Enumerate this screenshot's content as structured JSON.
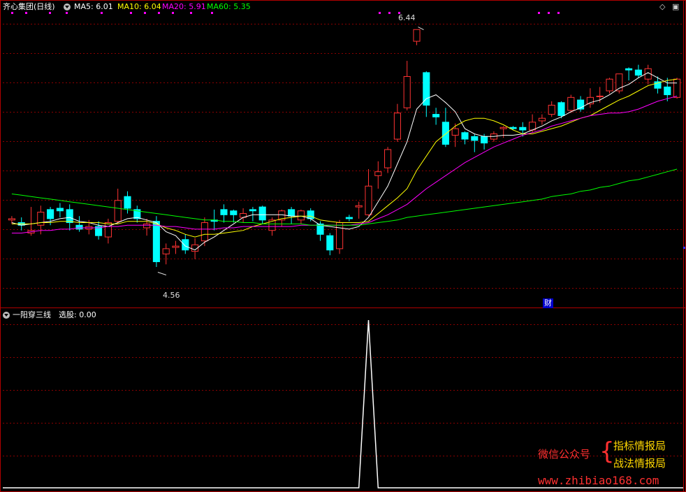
{
  "header": {
    "stock_name": "齐心集团(日线)",
    "ma_labels": [
      {
        "text": "MA5: 6.01",
        "color": "#ffffff"
      },
      {
        "text": "MA10: 6.04",
        "color": "#ffff00"
      },
      {
        "text": "MA20: 5.91",
        "color": "#ff00ff"
      },
      {
        "text": "MA60: 5.35",
        "color": "#00ff00"
      }
    ]
  },
  "indicator": {
    "name": "一阳穿三线",
    "value_label": "选股: 0.00"
  },
  "annotations": {
    "high_label": "6.44",
    "low_label": "4.56",
    "finance_marker": "财"
  },
  "watermark": {
    "prefix": "微信公众号",
    "line1": "指标情报局",
    "line2": "战法情报局",
    "url": "www.zhibiao168.com"
  },
  "controls": {
    "diamond_icon": "◇",
    "maximize_icon": "▣"
  },
  "colors": {
    "up": "#ff3333",
    "down": "#00ffff",
    "grid": "#8b0000",
    "frame": "#b00000",
    "ma5": "#ffffff",
    "ma10": "#ffff00",
    "ma20": "#ff00ff",
    "ma60": "#00ff00",
    "signal": "#ffffff"
  },
  "chart_data": [
    {
      "type": "candlestick",
      "title": "齐心集团(日线)",
      "ylim": [
        4.3,
        6.55
      ],
      "high_marker": 6.44,
      "low_marker": 4.56,
      "ohlc": [
        [
          4.96,
          4.99,
          4.93,
          4.97
        ],
        [
          4.94,
          4.98,
          4.88,
          4.92
        ],
        [
          4.86,
          5.06,
          4.84,
          4.88
        ],
        [
          4.92,
          5.07,
          4.85,
          5.02
        ],
        [
          5.04,
          5.06,
          4.92,
          4.97
        ],
        [
          5.05,
          5.09,
          4.98,
          5.03
        ],
        [
          5.04,
          5.08,
          4.88,
          4.94
        ],
        [
          4.92,
          4.99,
          4.87,
          4.89
        ],
        [
          4.89,
          4.96,
          4.85,
          4.91
        ],
        [
          4.91,
          4.95,
          4.81,
          4.84
        ],
        [
          4.83,
          4.97,
          4.78,
          4.94
        ],
        [
          4.95,
          5.2,
          4.93,
          5.11
        ],
        [
          5.14,
          5.18,
          5.01,
          5.05
        ],
        [
          5.04,
          5.07,
          4.94,
          4.97
        ],
        [
          4.9,
          4.97,
          4.84,
          4.93
        ],
        [
          4.95,
          4.99,
          4.6,
          4.64
        ],
        [
          4.7,
          4.78,
          4.62,
          4.74
        ],
        [
          4.75,
          4.8,
          4.7,
          4.76
        ],
        [
          4.81,
          4.85,
          4.7,
          4.73
        ],
        [
          4.72,
          4.82,
          4.66,
          4.77
        ],
        [
          4.8,
          4.98,
          4.76,
          4.94
        ],
        [
          4.96,
          5.04,
          4.88,
          4.95
        ],
        [
          5.04,
          5.08,
          4.94,
          5.0
        ],
        [
          5.03,
          5.04,
          4.94,
          5.0
        ],
        [
          4.98,
          5.05,
          4.94,
          5.01
        ],
        [
          5.04,
          5.06,
          4.95,
          5.03
        ],
        [
          5.06,
          5.07,
          4.93,
          4.96
        ],
        [
          4.88,
          4.98,
          4.84,
          4.96
        ],
        [
          4.96,
          5.04,
          4.91,
          5.03
        ],
        [
          5.04,
          5.06,
          4.93,
          4.99
        ],
        [
          4.96,
          5.04,
          4.93,
          5.03
        ],
        [
          5.03,
          5.05,
          4.95,
          4.97
        ],
        [
          4.93,
          4.95,
          4.8,
          4.85
        ],
        [
          4.84,
          4.86,
          4.69,
          4.73
        ],
        [
          4.74,
          4.96,
          4.7,
          4.94
        ],
        [
          4.98,
          5.0,
          4.95,
          4.97
        ],
        [
          5.06,
          5.1,
          4.97,
          5.07
        ],
        [
          5.0,
          5.35,
          4.99,
          5.22
        ],
        [
          5.3,
          5.41,
          5.2,
          5.33
        ],
        [
          5.36,
          5.52,
          5.32,
          5.5
        ],
        [
          5.58,
          5.85,
          5.56,
          5.78
        ],
        [
          5.82,
          6.18,
          5.8,
          6.06
        ],
        [
          6.33,
          6.42,
          6.3,
          6.42
        ],
        [
          6.09,
          6.1,
          5.75,
          5.84
        ],
        [
          5.77,
          5.82,
          5.69,
          5.75
        ],
        [
          5.71,
          5.82,
          5.52,
          5.54
        ],
        [
          5.61,
          5.7,
          5.52,
          5.66
        ],
        [
          5.63,
          5.64,
          5.54,
          5.58
        ],
        [
          5.6,
          5.62,
          5.48,
          5.57
        ],
        [
          5.6,
          5.62,
          5.5,
          5.55
        ],
        [
          5.58,
          5.64,
          5.56,
          5.62
        ],
        [
          5.66,
          5.68,
          5.59,
          5.67
        ],
        [
          5.67,
          5.68,
          5.65,
          5.66
        ],
        [
          5.67,
          5.71,
          5.6,
          5.65
        ],
        [
          5.65,
          5.77,
          5.63,
          5.71
        ],
        [
          5.72,
          5.77,
          5.69,
          5.74
        ],
        [
          5.77,
          5.87,
          5.75,
          5.84
        ],
        [
          5.86,
          5.87,
          5.74,
          5.76
        ],
        [
          5.8,
          5.92,
          5.78,
          5.9
        ],
        [
          5.88,
          5.91,
          5.79,
          5.81
        ],
        [
          5.85,
          5.97,
          5.82,
          5.9
        ],
        [
          5.91,
          5.98,
          5.86,
          5.91
        ],
        [
          5.95,
          6.05,
          5.93,
          6.04
        ],
        [
          5.95,
          6.08,
          5.93,
          6.08
        ],
        [
          6.12,
          6.13,
          6.03,
          6.11
        ],
        [
          6.11,
          6.15,
          6.05,
          6.07
        ],
        [
          6.04,
          6.15,
          6.0,
          6.12
        ],
        [
          6.02,
          6.06,
          5.93,
          5.97
        ],
        [
          5.98,
          6.05,
          5.87,
          5.92
        ],
        [
          5.9,
          6.05,
          5.89,
          6.04
        ]
      ],
      "ma": {
        "MA5": [
          4.94,
          4.92,
          4.93,
          4.94,
          4.95,
          4.97,
          4.98,
          4.95,
          4.94,
          4.92,
          4.91,
          4.94,
          4.97,
          4.98,
          4.96,
          4.94,
          4.87,
          4.84,
          4.76,
          4.73,
          4.79,
          4.83,
          4.88,
          4.93,
          4.98,
          5.0,
          5.0,
          5.0,
          5.0,
          4.99,
          4.99,
          4.97,
          4.92,
          4.91,
          4.9,
          4.89,
          4.91,
          4.98,
          5.1,
          5.22,
          5.39,
          5.56,
          5.81,
          5.89,
          5.92,
          5.86,
          5.79,
          5.66,
          5.62,
          5.6,
          5.6,
          5.61,
          5.61,
          5.62,
          5.65,
          5.68,
          5.72,
          5.75,
          5.79,
          5.82,
          5.86,
          5.88,
          5.92,
          5.97,
          6.0,
          6.05,
          6.09,
          6.05,
          6.01,
          6.01
        ],
        "MA10": [
          4.93,
          4.93,
          4.93,
          4.94,
          4.94,
          4.95,
          4.95,
          4.94,
          4.94,
          4.94,
          4.93,
          4.93,
          4.95,
          4.95,
          4.95,
          4.93,
          4.9,
          4.88,
          4.85,
          4.83,
          4.85,
          4.85,
          4.86,
          4.87,
          4.88,
          4.91,
          4.93,
          4.95,
          4.97,
          4.98,
          4.99,
          4.99,
          4.96,
          4.95,
          4.94,
          4.94,
          4.94,
          4.95,
          5.01,
          5.07,
          5.13,
          5.2,
          5.34,
          5.45,
          5.56,
          5.62,
          5.68,
          5.72,
          5.74,
          5.74,
          5.72,
          5.69,
          5.65,
          5.62,
          5.62,
          5.64,
          5.66,
          5.68,
          5.71,
          5.74,
          5.76,
          5.8,
          5.84,
          5.88,
          5.91,
          5.95,
          5.99,
          6.01,
          6.03,
          6.04
        ],
        "MA20": [
          4.86,
          4.86,
          4.87,
          4.88,
          4.88,
          4.89,
          4.89,
          4.9,
          4.9,
          4.9,
          4.91,
          4.91,
          4.92,
          4.92,
          4.92,
          4.92,
          4.91,
          4.91,
          4.9,
          4.89,
          4.89,
          4.89,
          4.9,
          4.9,
          4.91,
          4.91,
          4.91,
          4.91,
          4.91,
          4.91,
          4.92,
          4.92,
          4.92,
          4.92,
          4.92,
          4.92,
          4.93,
          4.94,
          4.97,
          5.0,
          5.04,
          5.08,
          5.14,
          5.2,
          5.25,
          5.3,
          5.35,
          5.4,
          5.44,
          5.48,
          5.52,
          5.55,
          5.58,
          5.61,
          5.63,
          5.65,
          5.68,
          5.7,
          5.72,
          5.74,
          5.76,
          5.77,
          5.78,
          5.78,
          5.79,
          5.81,
          5.84,
          5.87,
          5.89,
          5.91
        ],
        "MA60": [
          5.16,
          5.15,
          5.14,
          5.13,
          5.12,
          5.11,
          5.1,
          5.09,
          5.08,
          5.07,
          5.06,
          5.05,
          5.04,
          5.03,
          5.02,
          5.01,
          5.0,
          4.99,
          4.98,
          4.97,
          4.96,
          4.96,
          4.95,
          4.95,
          4.94,
          4.94,
          4.93,
          4.93,
          4.93,
          4.93,
          4.93,
          4.92,
          4.92,
          4.92,
          4.92,
          4.92,
          4.92,
          4.93,
          4.94,
          4.95,
          4.96,
          4.98,
          4.99,
          5.0,
          5.01,
          5.02,
          5.03,
          5.04,
          5.05,
          5.06,
          5.07,
          5.08,
          5.09,
          5.1,
          5.11,
          5.12,
          5.14,
          5.15,
          5.16,
          5.18,
          5.19,
          5.21,
          5.22,
          5.24,
          5.26,
          5.27,
          5.29,
          5.31,
          5.33,
          5.35
        ]
      }
    },
    {
      "type": "line",
      "title": "一阳穿三线",
      "series": [
        {
          "name": "选股",
          "values": [
            0,
            0,
            0,
            0,
            0,
            0,
            0,
            0,
            0,
            0,
            0,
            0,
            0,
            0,
            0,
            0,
            0,
            0,
            0,
            0,
            0,
            0,
            0,
            0,
            0,
            0,
            0,
            0,
            0,
            0,
            0,
            0,
            0,
            0,
            0,
            0,
            0,
            1,
            0,
            0,
            0,
            0,
            0,
            0,
            0,
            0,
            0,
            0,
            0,
            0,
            0,
            0,
            0,
            0,
            0,
            0,
            0,
            0,
            0,
            0,
            0,
            0,
            0,
            0,
            0,
            0,
            0,
            0,
            0,
            0
          ]
        }
      ],
      "ylim": [
        0,
        1
      ]
    }
  ]
}
